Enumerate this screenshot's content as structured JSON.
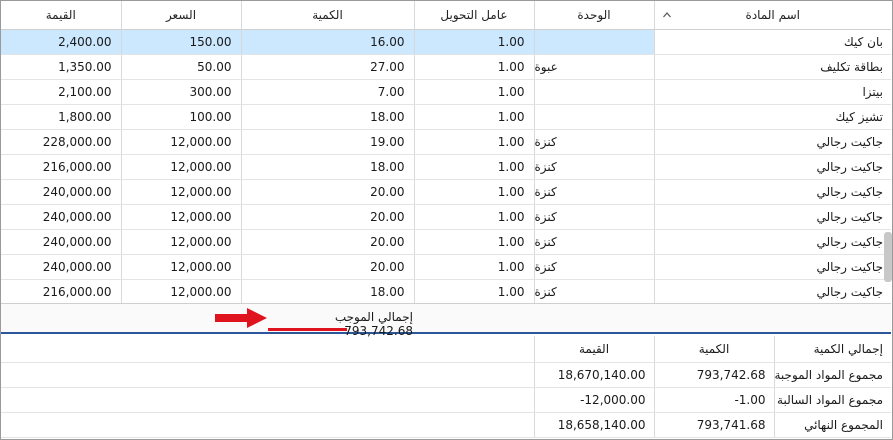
{
  "grid": {
    "columns": {
      "value": "القيمة",
      "price": "السعر",
      "quantity": "الكمية",
      "factor": "عامل التحويل",
      "unit": "الوحدة",
      "name": "اسم المادة"
    },
    "rows": [
      {
        "value": "2,400.00",
        "price": "150.00",
        "quantity": "16.00",
        "factor": "1.00",
        "unit": "",
        "name": "بان كيك"
      },
      {
        "value": "1,350.00",
        "price": "50.00",
        "quantity": "27.00",
        "factor": "1.00",
        "unit": "عبوة",
        "name": "بطاقة تكليف"
      },
      {
        "value": "2,100.00",
        "price": "300.00",
        "quantity": "7.00",
        "factor": "1.00",
        "unit": "",
        "name": "بيتزا"
      },
      {
        "value": "1,800.00",
        "price": "100.00",
        "quantity": "18.00",
        "factor": "1.00",
        "unit": "",
        "name": "تشيز كيك"
      },
      {
        "value": "228,000.00",
        "price": "12,000.00",
        "quantity": "19.00",
        "factor": "1.00",
        "unit": "كنزة",
        "name": "جاكيت رجالي"
      },
      {
        "value": "216,000.00",
        "price": "12,000.00",
        "quantity": "18.00",
        "factor": "1.00",
        "unit": "كنزة",
        "name": "جاكيت رجالي"
      },
      {
        "value": "240,000.00",
        "price": "12,000.00",
        "quantity": "20.00",
        "factor": "1.00",
        "unit": "كنزة",
        "name": "جاكيت رجالي"
      },
      {
        "value": "240,000.00",
        "price": "12,000.00",
        "quantity": "20.00",
        "factor": "1.00",
        "unit": "كنزة",
        "name": "جاكيت رجالي"
      },
      {
        "value": "240,000.00",
        "price": "12,000.00",
        "quantity": "20.00",
        "factor": "1.00",
        "unit": "كنزة",
        "name": "جاكيت رجالي"
      },
      {
        "value": "240,000.00",
        "price": "12,000.00",
        "quantity": "20.00",
        "factor": "1.00",
        "unit": "كنزة",
        "name": "جاكيت رجالي"
      },
      {
        "value": "216,000.00",
        "price": "12,000.00",
        "quantity": "18.00",
        "factor": "1.00",
        "unit": "كنزة",
        "name": "جاكيت رجالي"
      }
    ]
  },
  "footer": {
    "total_label": "إجمالي الموجب",
    "total_value": "793,742.68",
    "arrow_color": "#e0141e"
  },
  "summary": {
    "headers": {
      "label": "إجمالي الكمية",
      "quantity": "الكمية",
      "value": "القيمة"
    },
    "rows": [
      {
        "label": "مجموع المواد الموجبة",
        "quantity": "793,742.68",
        "value": "18,670,140.00"
      },
      {
        "label": "مجموع المواد السالبة",
        "quantity": "-1.00",
        "value": "-12,000.00"
      },
      {
        "label": "المجموع النهائي",
        "quantity": "793,741.68",
        "value": "18,658,140.00"
      }
    ]
  },
  "colors": {
    "selection": "#cce8ff",
    "accent_line": "#2b579a"
  },
  "icons": {
    "sort": "chevron-up-icon"
  }
}
